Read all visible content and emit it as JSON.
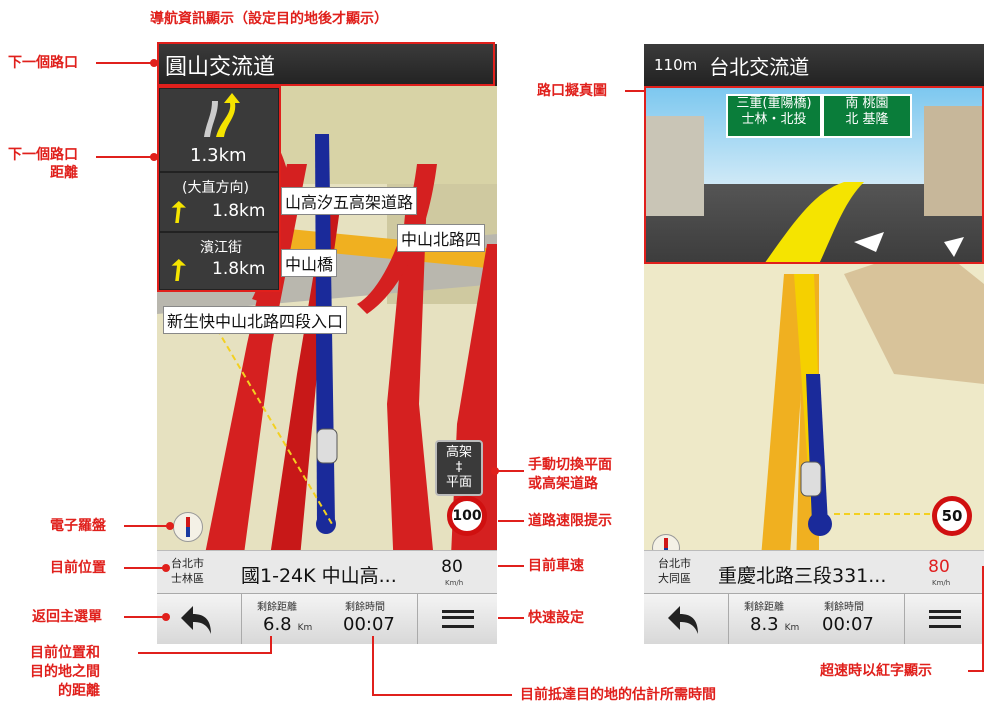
{
  "annotations": {
    "nav_info": "導航資訊顯示（設定目的地後才顯示）",
    "next_intersection": "下一個路口",
    "next_intersection_distance_line1": "下一個路口",
    "next_intersection_distance_line2": "距離",
    "compass": "電子羅盤",
    "current_location": "目前位置",
    "back_menu": "返回主選單",
    "distance_line1": "目前位置和",
    "distance_line2": "目的地之間",
    "distance_line3": "的距離",
    "eta": "目前抵達目的地的估計所需時間",
    "manual_switch_line1": "手動切換平面",
    "manual_switch_line2": "或高架道路",
    "speed_limit": "道路速限提示",
    "current_speed": "目前車速",
    "quick_settings": "快速設定",
    "junction_view": "路口擬真圖",
    "overspeed": "超速時以紅字顯示"
  },
  "left_screen": {
    "next_road": "圓山交流道",
    "turn1_distance": "1.3km",
    "turn2_label": "(大直方向)",
    "turn2_distance": "1.8km",
    "turn3_label": "濱江街",
    "turn3_distance": "1.8km",
    "map_labels": {
      "label1": "山高汐五高架道路",
      "label2": "中山北路四",
      "label3": "中山橋",
      "label4": "新生快中山北路四段入口"
    },
    "elevated_toggle": {
      "top": "高架",
      "mid": "‡",
      "bottom": "平面"
    },
    "speed_limit": "100",
    "location_city": "台北市",
    "location_district": "士林區",
    "road": "國1-24K 中山高...",
    "speed": "80",
    "speed_unit": "Km/h",
    "remaining_distance_label": "剩餘距離",
    "remaining_distance": "6.8",
    "distance_unit": "Km",
    "remaining_time_label": "剩餘時間",
    "remaining_time": "00:07"
  },
  "right_screen": {
    "distance": "110m",
    "next_road": "台北交流道",
    "sign_left_line1": "三重(重陽橋)",
    "sign_left_line2": "士林・北投",
    "sign_right_line1": "南 桃園",
    "sign_right_line2": "北 基隆",
    "speed_limit": "50",
    "location_city": "台北市",
    "location_district": "大同區",
    "road": "重慶北路三段331...",
    "speed": "80",
    "speed_unit": "Km/h",
    "remaining_distance_label": "剩餘距離",
    "remaining_distance": "8.3",
    "distance_unit": "Km",
    "remaining_time_label": "剩餘時間",
    "remaining_time": "00:07"
  },
  "colors": {
    "annotation_red": "#e0201c",
    "overspeed_red": "#e02020",
    "route_blue": "#1a2a9a",
    "road_red": "#d52020",
    "road_yellow": "#f0b020"
  }
}
